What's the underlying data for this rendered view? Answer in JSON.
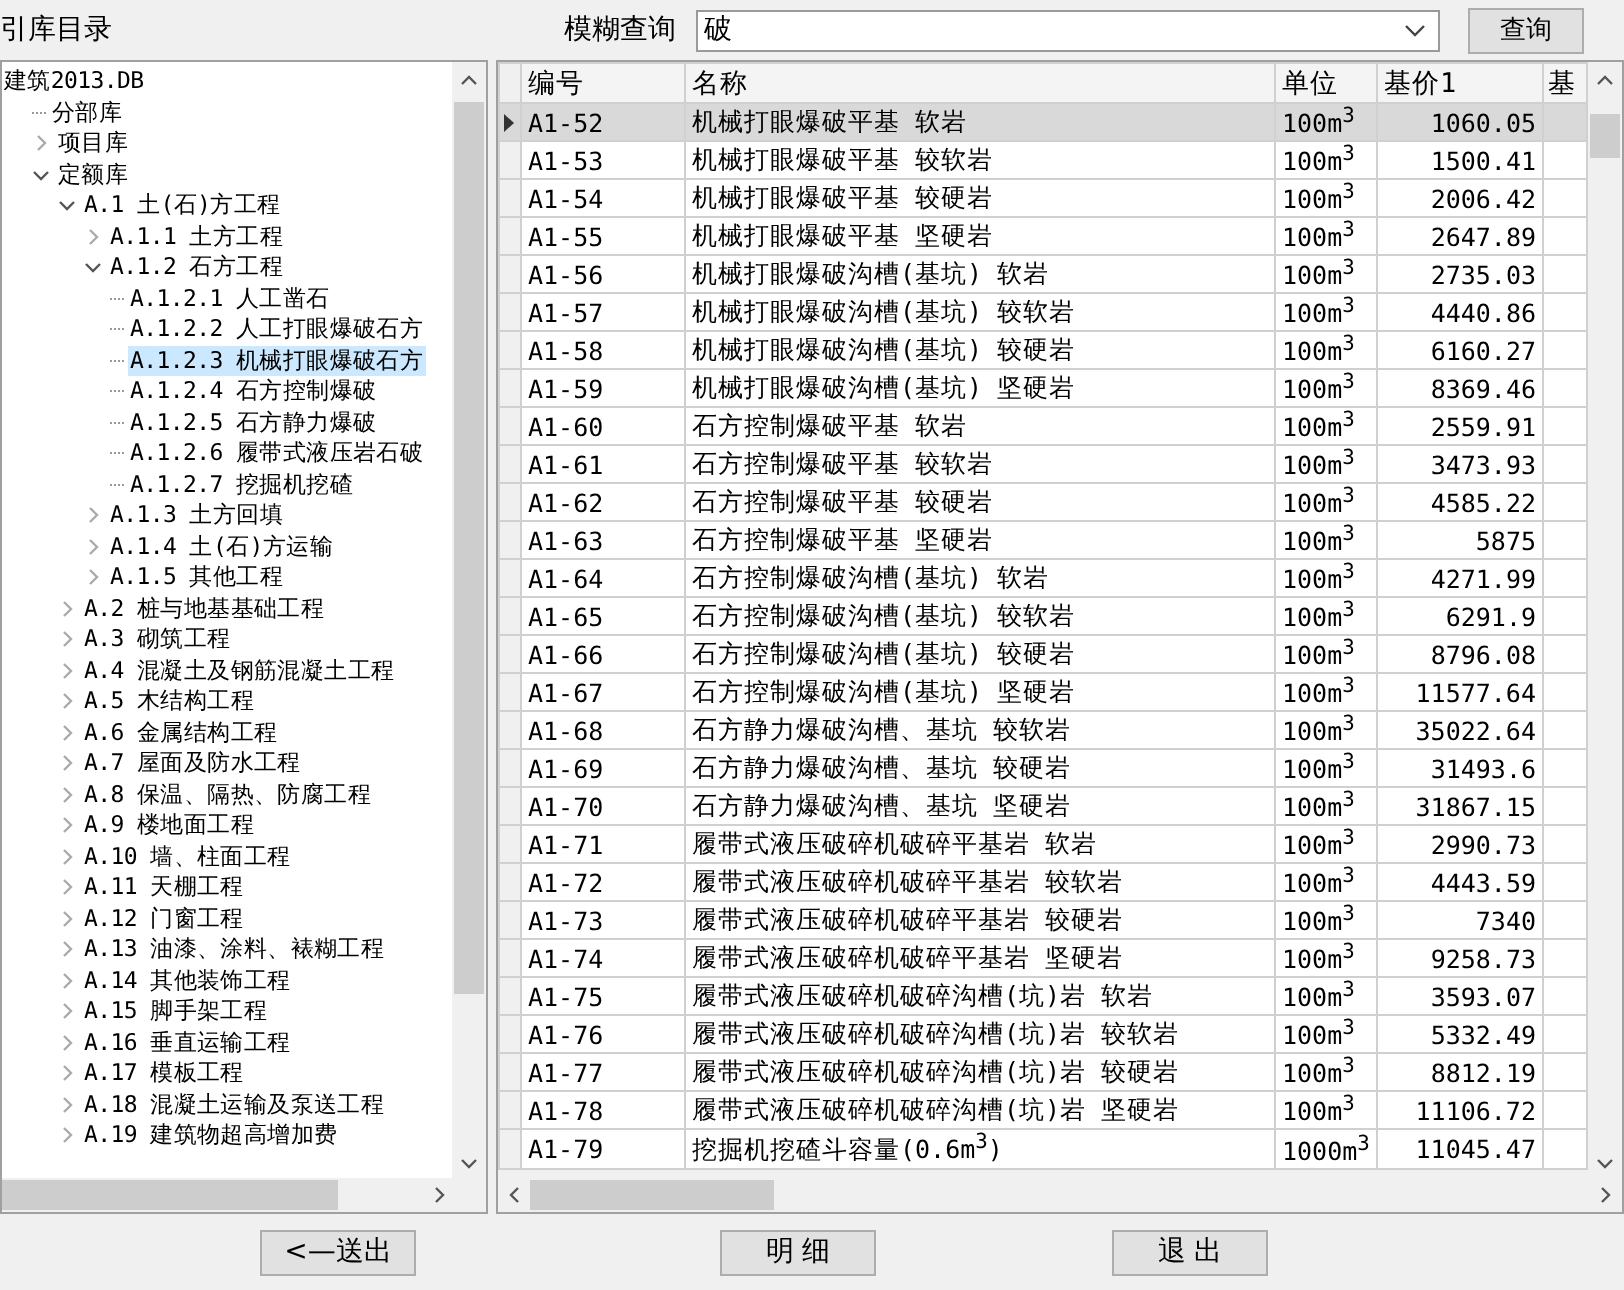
{
  "panel_title": "引库目录",
  "search": {
    "label": "模糊查询",
    "value": "破",
    "button": "查询"
  },
  "tree": {
    "items": [
      {
        "label": "建筑2013.DB",
        "selected": false,
        "children": [
          {
            "label": "分部库",
            "selected": false
          },
          {
            "label": "项目库",
            "selected": false,
            "expanded": false
          },
          {
            "label": "定额库",
            "selected": false,
            "expanded": true,
            "children": [
              {
                "label": "A.1 土(石)方工程",
                "selected": false,
                "expanded": true,
                "children": [
                  {
                    "label": "A.1.1 土方工程",
                    "selected": false,
                    "expanded": false
                  },
                  {
                    "label": "A.1.2 石方工程",
                    "selected": false,
                    "expanded": true,
                    "children": [
                      {
                        "label": "A.1.2.1 人工凿石",
                        "selected": false
                      },
                      {
                        "label": "A.1.2.2 人工打眼爆破石方",
                        "selected": false
                      },
                      {
                        "label": "A.1.2.3 机械打眼爆破石方",
                        "selected": true
                      },
                      {
                        "label": "A.1.2.4 石方控制爆破",
                        "selected": false
                      },
                      {
                        "label": "A.1.2.5 石方静力爆破",
                        "selected": false
                      },
                      {
                        "label": "A.1.2.6 履带式液压岩石破",
                        "selected": false
                      },
                      {
                        "label": "A.1.2.7 挖掘机挖碴",
                        "selected": false
                      }
                    ]
                  },
                  {
                    "label": "A.1.3 土方回填",
                    "selected": false,
                    "expanded": false
                  },
                  {
                    "label": "A.1.4 土(石)方运输",
                    "selected": false,
                    "expanded": false
                  },
                  {
                    "label": "A.1.5 其他工程",
                    "selected": false,
                    "expanded": false
                  }
                ]
              },
              {
                "label": "A.2 桩与地基基础工程",
                "selected": false,
                "expanded": false
              },
              {
                "label": "A.3 砌筑工程",
                "selected": false,
                "expanded": false
              },
              {
                "label": "A.4 混凝土及钢筋混凝土工程",
                "selected": false,
                "expanded": false
              },
              {
                "label": "A.5 木结构工程",
                "selected": false,
                "expanded": false
              },
              {
                "label": "A.6 金属结构工程",
                "selected": false,
                "expanded": false
              },
              {
                "label": "A.7 屋面及防水工程",
                "selected": false,
                "expanded": false
              },
              {
                "label": "A.8 保温、隔热、防腐工程",
                "selected": false,
                "expanded": false
              },
              {
                "label": "A.9 楼地面工程",
                "selected": false,
                "expanded": false
              },
              {
                "label": "A.10 墙、柱面工程",
                "selected": false,
                "expanded": false
              },
              {
                "label": "A.11 天棚工程",
                "selected": false,
                "expanded": false
              },
              {
                "label": "A.12 门窗工程",
                "selected": false,
                "expanded": false
              },
              {
                "label": "A.13 油漆、涂料、裱糊工程",
                "selected": false,
                "expanded": false
              },
              {
                "label": "A.14 其他装饰工程",
                "selected": false,
                "expanded": false
              },
              {
                "label": "A.15 脚手架工程",
                "selected": false,
                "expanded": false
              },
              {
                "label": "A.16 垂直运输工程",
                "selected": false,
                "expanded": false
              },
              {
                "label": "A.17 模板工程",
                "selected": false,
                "expanded": false
              },
              {
                "label": "A.18 混凝土运输及泵送工程",
                "selected": false,
                "expanded": false
              },
              {
                "label": "A.19 建筑物超高增加费",
                "selected": false,
                "expanded": false
              }
            ]
          }
        ]
      }
    ]
  },
  "table": {
    "columns": [
      "编号",
      "名称",
      "单位",
      "基价1",
      "基"
    ],
    "rows": [
      {
        "code": "A1-52",
        "name": "机械打眼爆破平基 软岩",
        "unit": "100m$^{3}$",
        "price": "1060.05",
        "selected": true
      },
      {
        "code": "A1-53",
        "name": "机械打眼爆破平基 较软岩",
        "unit": "100m$^{3}$",
        "price": "1500.41",
        "selected": false
      },
      {
        "code": "A1-54",
        "name": "机械打眼爆破平基 较硬岩",
        "unit": "100m$^{3}$",
        "price": "2006.42",
        "selected": false
      },
      {
        "code": "A1-55",
        "name": "机械打眼爆破平基 坚硬岩",
        "unit": "100m$^{3}$",
        "price": "2647.89",
        "selected": false
      },
      {
        "code": "A1-56",
        "name": "机械打眼爆破沟槽(基坑) 软岩",
        "unit": "100m$^{3}$",
        "price": "2735.03",
        "selected": false
      },
      {
        "code": "A1-57",
        "name": "机械打眼爆破沟槽(基坑) 较软岩",
        "unit": "100m$^{3}$",
        "price": "4440.86",
        "selected": false
      },
      {
        "code": "A1-58",
        "name": "机械打眼爆破沟槽(基坑) 较硬岩",
        "unit": "100m$^{3}$",
        "price": "6160.27",
        "selected": false
      },
      {
        "code": "A1-59",
        "name": "机械打眼爆破沟槽(基坑) 坚硬岩",
        "unit": "100m$^{3}$",
        "price": "8369.46",
        "selected": false
      },
      {
        "code": "A1-60",
        "name": "石方控制爆破平基 软岩",
        "unit": "100m$^{3}$",
        "price": "2559.91",
        "selected": false
      },
      {
        "code": "A1-61",
        "name": "石方控制爆破平基 较软岩",
        "unit": "100m$^{3}$",
        "price": "3473.93",
        "selected": false
      },
      {
        "code": "A1-62",
        "name": "石方控制爆破平基 较硬岩",
        "unit": "100m$^{3}$",
        "price": "4585.22",
        "selected": false
      },
      {
        "code": "A1-63",
        "name": "石方控制爆破平基 坚硬岩",
        "unit": "100m$^{3}$",
        "price": "5875",
        "selected": false
      },
      {
        "code": "A1-64",
        "name": "石方控制爆破沟槽(基坑) 软岩",
        "unit": "100m$^{3}$",
        "price": "4271.99",
        "selected": false
      },
      {
        "code": "A1-65",
        "name": "石方控制爆破沟槽(基坑) 较软岩",
        "unit": "100m$^{3}$",
        "price": "6291.9",
        "selected": false
      },
      {
        "code": "A1-66",
        "name": "石方控制爆破沟槽(基坑) 较硬岩",
        "unit": "100m$^{3}$",
        "price": "8796.08",
        "selected": false
      },
      {
        "code": "A1-67",
        "name": "石方控制爆破沟槽(基坑) 坚硬岩",
        "unit": "100m$^{3}$",
        "price": "11577.64",
        "selected": false
      },
      {
        "code": "A1-68",
        "name": "石方静力爆破沟槽、基坑 较软岩",
        "unit": "100m$^{3}$",
        "price": "35022.64",
        "selected": false
      },
      {
        "code": "A1-69",
        "name": "石方静力爆破沟槽、基坑 较硬岩",
        "unit": "100m$^{3}$",
        "price": "31493.6",
        "selected": false
      },
      {
        "code": "A1-70",
        "name": "石方静力爆破沟槽、基坑 坚硬岩",
        "unit": "100m$^{3}$",
        "price": "31867.15",
        "selected": false
      },
      {
        "code": "A1-71",
        "name": "履带式液压破碎机破碎平基岩 软岩",
        "unit": "100m$^{3}$",
        "price": "2990.73",
        "selected": false
      },
      {
        "code": "A1-72",
        "name": "履带式液压破碎机破碎平基岩 较软岩",
        "unit": "100m$^{3}$",
        "price": "4443.59",
        "selected": false
      },
      {
        "code": "A1-73",
        "name": "履带式液压破碎机破碎平基岩 较硬岩",
        "unit": "100m$^{3}$",
        "price": "7340",
        "selected": false
      },
      {
        "code": "A1-74",
        "name": "履带式液压破碎机破碎平基岩 坚硬岩",
        "unit": "100m$^{3}$",
        "price": "9258.73",
        "selected": false
      },
      {
        "code": "A1-75",
        "name": "履带式液压破碎机破碎沟槽(坑)岩 软岩",
        "unit": "100m$^{3}$",
        "price": "3593.07",
        "selected": false
      },
      {
        "code": "A1-76",
        "name": "履带式液压破碎机破碎沟槽(坑)岩 较软岩",
        "unit": "100m$^{3}$",
        "price": "5332.49",
        "selected": false
      },
      {
        "code": "A1-77",
        "name": "履带式液压破碎机破碎沟槽(坑)岩 较硬岩",
        "unit": "100m$^{3}$",
        "price": "8812.19",
        "selected": false
      },
      {
        "code": "A1-78",
        "name": "履带式液压破碎机破碎沟槽(坑)岩 坚硬岩",
        "unit": "100m$^{3}$",
        "price": "11106.72",
        "selected": false
      },
      {
        "code": "A1-79",
        "name": "挖掘机挖碴斗容量(0.6m$^{3}$)",
        "unit": "1000m$^{3}$",
        "price": "11045.47",
        "selected": false
      }
    ]
  },
  "buttons": [
    "<—送出",
    "明 细",
    "退 出"
  ]
}
